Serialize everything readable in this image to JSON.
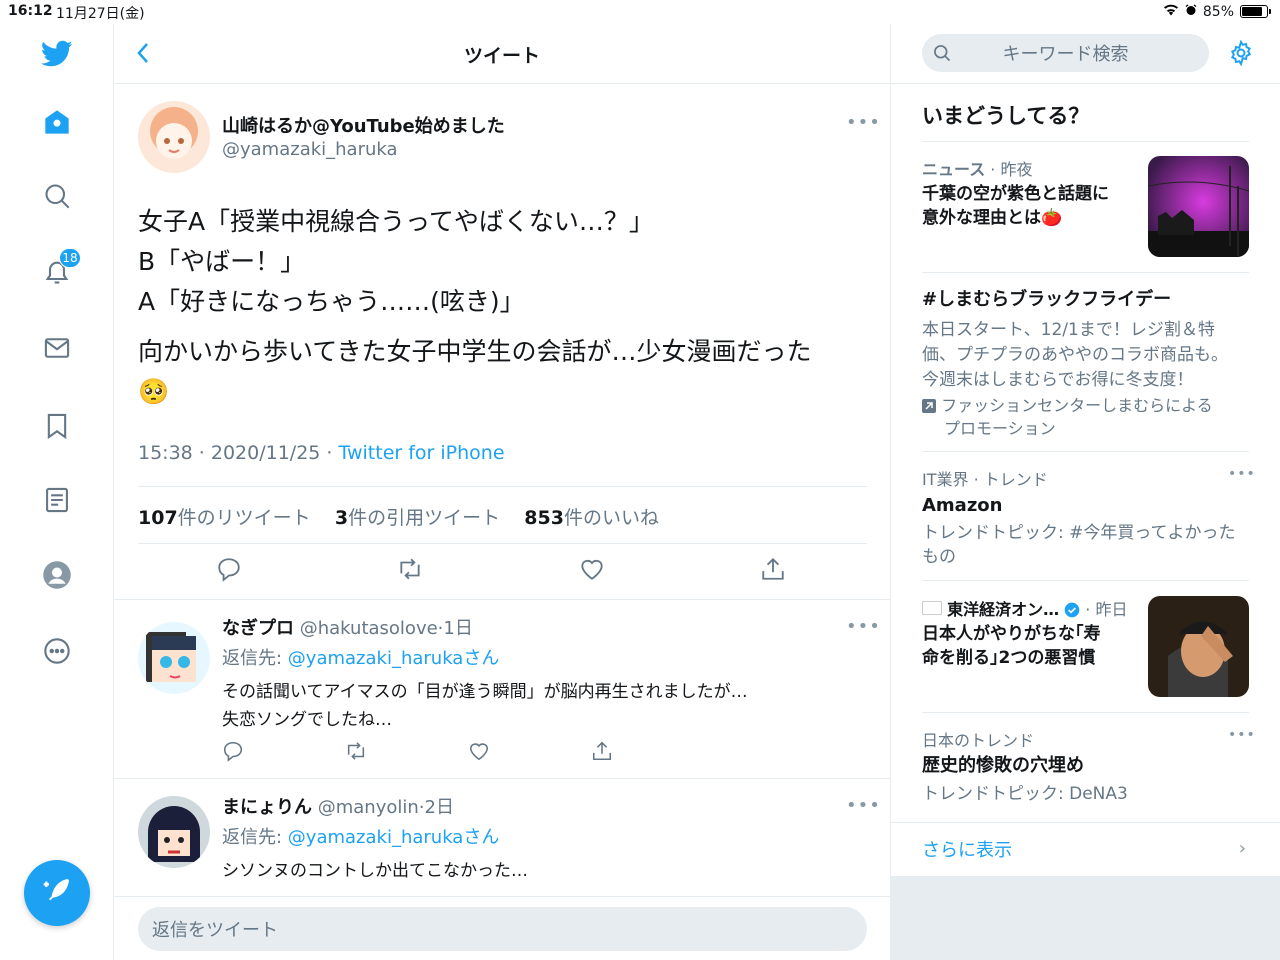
{
  "status": {
    "time": "16:12",
    "date": "11月27日(金)",
    "battery": "85%",
    "battery_level": 0.85
  },
  "nav": {
    "notification_badge": "18"
  },
  "header": {
    "title": "ツイート"
  },
  "tweet": {
    "author_name": "山崎はるか@YouTube始めました",
    "author_handle": "@yamazaki_haruka",
    "lines": [
      "女子A「授業中視線合うってやばくない…？」",
      "B「やばー！」",
      "A「好きになっちゃう……(呟き)」"
    ],
    "line2": "向かいから歩いてきた女子中学生の会話が…少女漫画だった",
    "emoji": "🥺",
    "timestamp": "15:38 · 2020/11/25 · ",
    "source": "Twitter for iPhone",
    "retweets_count": "107",
    "retweets_label": "件のリツイート",
    "quotes_count": "3",
    "quotes_label": "件の引用ツイート",
    "likes_count": "853",
    "likes_label": "件のいいね"
  },
  "replies": [
    {
      "name": "なぎプロ",
      "handle": "@hakutasolove",
      "time": "1日",
      "reply_to_prefix": "返信先: ",
      "reply_to": "@yamazaki_haruka",
      "reply_to_suffix": "さん",
      "text1": "その話聞いてアイマスの「目が逢う瞬間」が脳内再生されましたが…",
      "text2": "失恋ソングでしたね…"
    },
    {
      "name": "まにょりん",
      "handle": "@manyolin",
      "time": "2日",
      "reply_to_prefix": "返信先: ",
      "reply_to": "@yamazaki_haruka",
      "reply_to_suffix": "さん",
      "text1": "シソンヌのコントしか出てこなかった…"
    }
  ],
  "reply_box": {
    "placeholder": "返信をツイート"
  },
  "sidebar": {
    "search_placeholder": "キーワード検索",
    "title": "いまどうしてる？",
    "trends": [
      {
        "category": "ニュース",
        "time": "· 昨夜",
        "headline1": "千葉の空が紫色と話題に",
        "headline2": "意外な理由とは🍅"
      },
      {
        "headline": "#しまむらブラックフライデー",
        "desc": "本日スタート、12/1まで！レジ割＆特価、プチプラのあややのコラボ商品も。今週末はしまむらでお得に冬支度！",
        "promo1": "ファッションセンターしまむらによる",
        "promo2": "プロモーション"
      },
      {
        "category": "IT業界 · トレンド",
        "headline": "Amazon",
        "desc": "トレンドトピック: #今年買ってよかったもの"
      },
      {
        "source": "東洋経済オン…",
        "time": "· 昨日",
        "headline1": "日本人がやりがちな｢寿",
        "headline2": "命を削る｣2つの悪習慣"
      },
      {
        "category": "日本のトレンド",
        "headline": "歴史的惨敗の穴埋め",
        "desc": "トレンドトピック: DeNA3"
      }
    ],
    "show_more": "さらに表示"
  },
  "colors": {
    "accent": "#1da1f2",
    "muted": "#657786",
    "border": "#e6ecf0"
  },
  "icons": [
    "twitter-logo-icon",
    "home-icon",
    "search-icon",
    "bell-icon",
    "mail-icon",
    "bookmark-icon",
    "list-icon",
    "profile-icon",
    "more-icon",
    "compose-icon",
    "back-icon",
    "gear-icon",
    "reply-icon",
    "retweet-icon",
    "like-icon",
    "share-icon",
    "verified-icon",
    "promoted-icon",
    "chevron-right-icon"
  ]
}
